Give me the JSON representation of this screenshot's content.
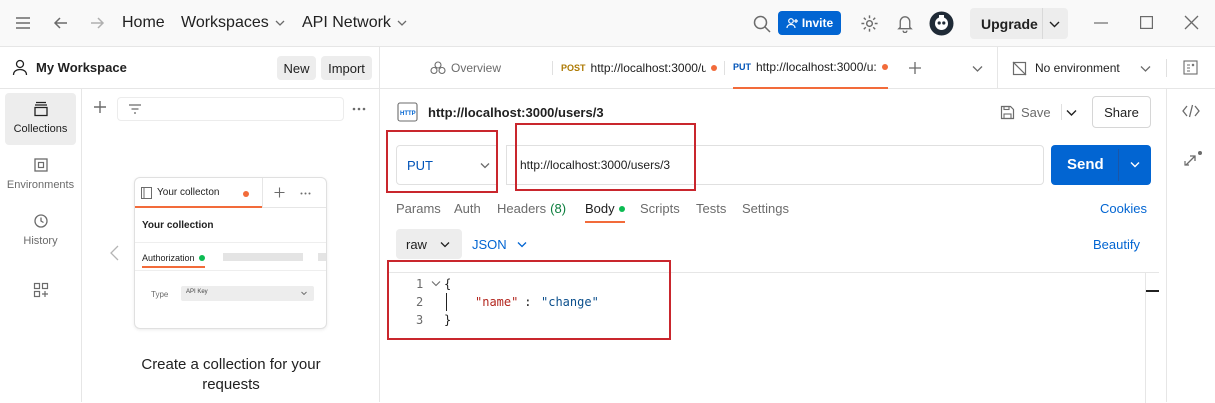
{
  "topbar": {
    "home": "Home",
    "workspaces": "Workspaces",
    "api_network": "API Network",
    "invite": "Invite",
    "upgrade": "Upgrade"
  },
  "workspace": {
    "name": "My Workspace",
    "new": "New",
    "import": "Import"
  },
  "nav": {
    "items": [
      {
        "label": "Collections",
        "icon": "collections-icon"
      },
      {
        "label": "Environments",
        "icon": "environments-icon"
      },
      {
        "label": "History",
        "icon": "history-icon"
      },
      {
        "label": "",
        "icon": "apps-icon"
      }
    ]
  },
  "collections_panel": {
    "mini_tab": "Your collecton",
    "mini_title": "Your collection",
    "mini_auth": "Authorization",
    "mini_type_label": "Type",
    "mini_type_value": "API Key",
    "empty_title": "Create a collection for your requests"
  },
  "tabs": {
    "overview": "Overview",
    "tab1_method": "POST",
    "tab1_url": "http://localhost:3000/u",
    "tab2_method": "PUT",
    "tab2_url": "http://localhost:3000/u:",
    "environment": "No environment"
  },
  "request": {
    "title": "http://localhost:3000/users/3",
    "save": "Save",
    "share": "Share",
    "method": "PUT",
    "url": "http://localhost:3000/users/3",
    "send": "Send"
  },
  "request_tabs": {
    "params": "Params",
    "auth": "Auth",
    "headers": "Headers",
    "headers_count": "(8)",
    "body": "Body",
    "scripts": "Scripts",
    "tests": "Tests",
    "settings": "Settings",
    "cookies": "Cookies"
  },
  "body": {
    "mode": "raw",
    "format": "JSON",
    "beautify": "Beautify",
    "lines": [
      {
        "num": "1",
        "text": "{"
      },
      {
        "num": "2",
        "key": "\"name\"",
        "sep": " : ",
        "value": "\"change\""
      },
      {
        "num": "3",
        "text": "}"
      }
    ]
  },
  "colors": {
    "accent_blue": "#0265d2",
    "status_orange": "#f26b3a",
    "status_green": "#0cbb52",
    "highlight_red": "#c9262d"
  }
}
